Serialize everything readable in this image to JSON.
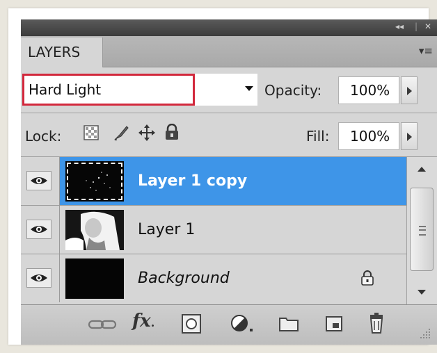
{
  "panel": {
    "tab_label": "LAYERS",
    "collapse_glyph": "◂◂",
    "close_glyph": "✕",
    "menu_glyph": "▾≡"
  },
  "blend": {
    "mode": "Hard Light"
  },
  "opacity": {
    "label": "Opacity:",
    "value": "100%"
  },
  "lock": {
    "label": "Lock:",
    "icons": [
      "lock-transparent-pixels-icon",
      "lock-image-pixels-icon",
      "lock-position-icon",
      "lock-all-icon"
    ]
  },
  "fill": {
    "label": "Fill:",
    "value": "100%"
  },
  "layers": [
    {
      "name": "Layer 1 copy",
      "selected": true,
      "visible": true,
      "locked": false
    },
    {
      "name": "Layer 1",
      "selected": false,
      "visible": true,
      "locked": false
    },
    {
      "name": "Background",
      "selected": false,
      "visible": true,
      "locked": true
    }
  ],
  "toolbar": {
    "icons": [
      "link-layers-icon",
      "fx-icon",
      "layer-mask-icon",
      "adjustment-layer-icon",
      "new-group-icon",
      "new-layer-icon",
      "delete-layer-icon"
    ],
    "fx_text": "fx"
  },
  "colors": {
    "selection": "#3e95e8",
    "highlight_border": "#d2283c",
    "panel_bg": "#d6d6d6"
  }
}
